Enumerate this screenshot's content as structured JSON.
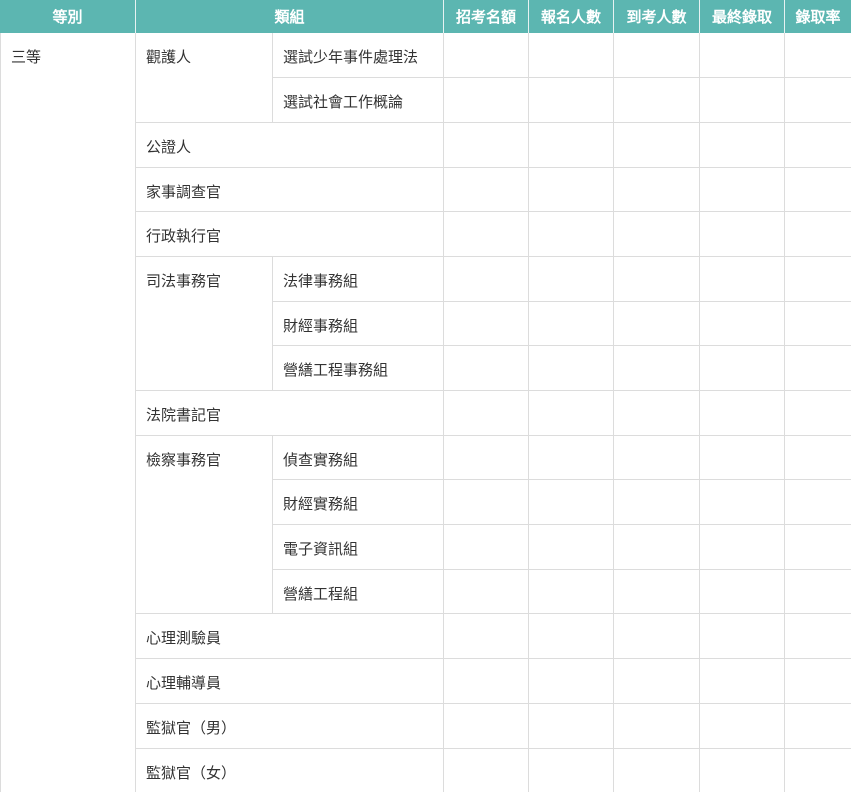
{
  "headers": [
    "等別",
    "類組",
    "招考名額",
    "報名人數",
    "到考人數",
    "最終錄取",
    "錄取率"
  ],
  "grade": "三等",
  "categories": {
    "guardian": "觀護人",
    "notary": "公證人",
    "family_investigator": "家事調查官",
    "enforcement_officer": "行政執行官",
    "judicial_affairs_officer": "司法事務官",
    "court_clerk": "法院書記官",
    "prosecution_affairs_officer": "檢察事務官",
    "psych_tester": "心理測驗員",
    "psych_counselor": "心理輔導員",
    "prison_officer_male": "監獄官（男）",
    "prison_officer_female": "監獄官（女）"
  },
  "subgroups": {
    "guardian_juvenile": "選試少年事件處理法",
    "guardian_social": "選試社會工作概論",
    "jao_legal": "法律事務組",
    "jao_finance": "財經事務組",
    "jao_construction": "營繕工程事務組",
    "pao_investigation": "偵查實務組",
    "pao_finance": "財經實務組",
    "pao_it": "電子資訊組",
    "pao_construction": "營繕工程組"
  }
}
